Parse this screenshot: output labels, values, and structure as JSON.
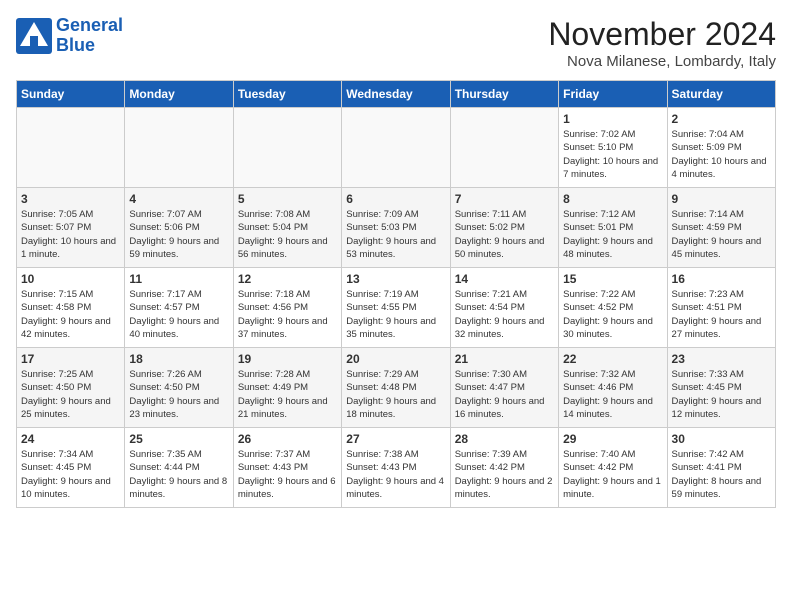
{
  "logo": {
    "line1": "General",
    "line2": "Blue"
  },
  "title": "November 2024",
  "location": "Nova Milanese, Lombardy, Italy",
  "days_of_week": [
    "Sunday",
    "Monday",
    "Tuesday",
    "Wednesday",
    "Thursday",
    "Friday",
    "Saturday"
  ],
  "weeks": [
    [
      {
        "day": "",
        "info": ""
      },
      {
        "day": "",
        "info": ""
      },
      {
        "day": "",
        "info": ""
      },
      {
        "day": "",
        "info": ""
      },
      {
        "day": "",
        "info": ""
      },
      {
        "day": "1",
        "info": "Sunrise: 7:02 AM\nSunset: 5:10 PM\nDaylight: 10 hours and 7 minutes."
      },
      {
        "day": "2",
        "info": "Sunrise: 7:04 AM\nSunset: 5:09 PM\nDaylight: 10 hours and 4 minutes."
      }
    ],
    [
      {
        "day": "3",
        "info": "Sunrise: 7:05 AM\nSunset: 5:07 PM\nDaylight: 10 hours and 1 minute."
      },
      {
        "day": "4",
        "info": "Sunrise: 7:07 AM\nSunset: 5:06 PM\nDaylight: 9 hours and 59 minutes."
      },
      {
        "day": "5",
        "info": "Sunrise: 7:08 AM\nSunset: 5:04 PM\nDaylight: 9 hours and 56 minutes."
      },
      {
        "day": "6",
        "info": "Sunrise: 7:09 AM\nSunset: 5:03 PM\nDaylight: 9 hours and 53 minutes."
      },
      {
        "day": "7",
        "info": "Sunrise: 7:11 AM\nSunset: 5:02 PM\nDaylight: 9 hours and 50 minutes."
      },
      {
        "day": "8",
        "info": "Sunrise: 7:12 AM\nSunset: 5:01 PM\nDaylight: 9 hours and 48 minutes."
      },
      {
        "day": "9",
        "info": "Sunrise: 7:14 AM\nSunset: 4:59 PM\nDaylight: 9 hours and 45 minutes."
      }
    ],
    [
      {
        "day": "10",
        "info": "Sunrise: 7:15 AM\nSunset: 4:58 PM\nDaylight: 9 hours and 42 minutes."
      },
      {
        "day": "11",
        "info": "Sunrise: 7:17 AM\nSunset: 4:57 PM\nDaylight: 9 hours and 40 minutes."
      },
      {
        "day": "12",
        "info": "Sunrise: 7:18 AM\nSunset: 4:56 PM\nDaylight: 9 hours and 37 minutes."
      },
      {
        "day": "13",
        "info": "Sunrise: 7:19 AM\nSunset: 4:55 PM\nDaylight: 9 hours and 35 minutes."
      },
      {
        "day": "14",
        "info": "Sunrise: 7:21 AM\nSunset: 4:54 PM\nDaylight: 9 hours and 32 minutes."
      },
      {
        "day": "15",
        "info": "Sunrise: 7:22 AM\nSunset: 4:52 PM\nDaylight: 9 hours and 30 minutes."
      },
      {
        "day": "16",
        "info": "Sunrise: 7:23 AM\nSunset: 4:51 PM\nDaylight: 9 hours and 27 minutes."
      }
    ],
    [
      {
        "day": "17",
        "info": "Sunrise: 7:25 AM\nSunset: 4:50 PM\nDaylight: 9 hours and 25 minutes."
      },
      {
        "day": "18",
        "info": "Sunrise: 7:26 AM\nSunset: 4:50 PM\nDaylight: 9 hours and 23 minutes."
      },
      {
        "day": "19",
        "info": "Sunrise: 7:28 AM\nSunset: 4:49 PM\nDaylight: 9 hours and 21 minutes."
      },
      {
        "day": "20",
        "info": "Sunrise: 7:29 AM\nSunset: 4:48 PM\nDaylight: 9 hours and 18 minutes."
      },
      {
        "day": "21",
        "info": "Sunrise: 7:30 AM\nSunset: 4:47 PM\nDaylight: 9 hours and 16 minutes."
      },
      {
        "day": "22",
        "info": "Sunrise: 7:32 AM\nSunset: 4:46 PM\nDaylight: 9 hours and 14 minutes."
      },
      {
        "day": "23",
        "info": "Sunrise: 7:33 AM\nSunset: 4:45 PM\nDaylight: 9 hours and 12 minutes."
      }
    ],
    [
      {
        "day": "24",
        "info": "Sunrise: 7:34 AM\nSunset: 4:45 PM\nDaylight: 9 hours and 10 minutes."
      },
      {
        "day": "25",
        "info": "Sunrise: 7:35 AM\nSunset: 4:44 PM\nDaylight: 9 hours and 8 minutes."
      },
      {
        "day": "26",
        "info": "Sunrise: 7:37 AM\nSunset: 4:43 PM\nDaylight: 9 hours and 6 minutes."
      },
      {
        "day": "27",
        "info": "Sunrise: 7:38 AM\nSunset: 4:43 PM\nDaylight: 9 hours and 4 minutes."
      },
      {
        "day": "28",
        "info": "Sunrise: 7:39 AM\nSunset: 4:42 PM\nDaylight: 9 hours and 2 minutes."
      },
      {
        "day": "29",
        "info": "Sunrise: 7:40 AM\nSunset: 4:42 PM\nDaylight: 9 hours and 1 minute."
      },
      {
        "day": "30",
        "info": "Sunrise: 7:42 AM\nSunset: 4:41 PM\nDaylight: 8 hours and 59 minutes."
      }
    ]
  ]
}
